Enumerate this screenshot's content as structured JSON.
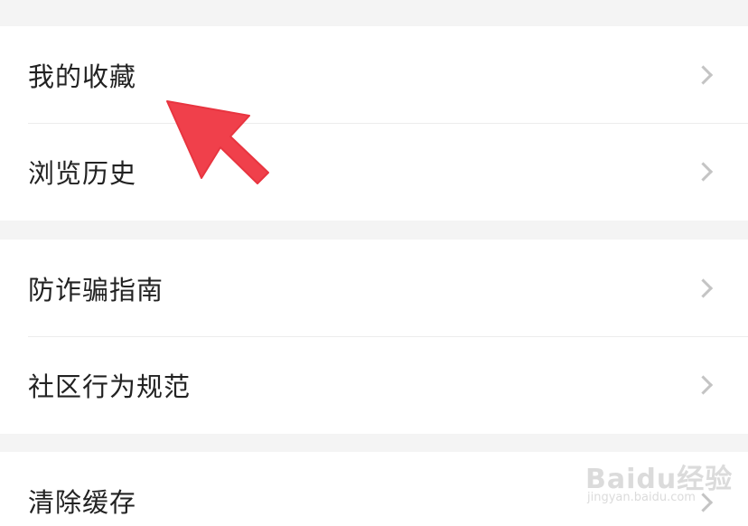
{
  "menu": {
    "group1": [
      {
        "label": "我的收藏"
      },
      {
        "label": "浏览历史"
      }
    ],
    "group2": [
      {
        "label": "防诈骗指南"
      },
      {
        "label": "社区行为规范"
      }
    ],
    "group3": [
      {
        "label": "清除缓存"
      }
    ]
  },
  "icons": {
    "chevron": "chevron-right-icon",
    "annotation": "red-pointer-arrow"
  },
  "colors": {
    "arrow": "#f0404b",
    "background": "#f4f4f4",
    "row": "#ffffff",
    "chevron": "#c4c4c4"
  },
  "watermark": {
    "main": "Baidu经验",
    "sub": "jingyan.baidu.com"
  }
}
